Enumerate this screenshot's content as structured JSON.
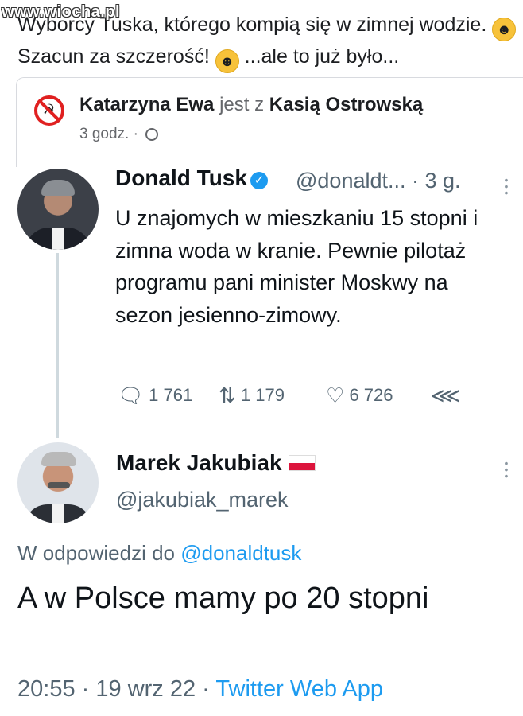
{
  "watermark": "www.wiocha.pl",
  "post": {
    "line1": "Wyborcy Tuska, którego kompią się w zimnej wodzie.",
    "line2_a": "Szacun za szczerość!",
    "line2_b": "...ale to już było...",
    "emoji_laugh": "laughing-emoji"
  },
  "shared": {
    "author": "Katarzyna Ewa",
    "with_word": "jest z",
    "with_name": "Kasią Ostrowską",
    "time": "3 godz.",
    "separator": "·"
  },
  "tweet1": {
    "name": "Donald Tusk",
    "handle": "@donaldt...",
    "time": "· 3 g.",
    "verified_icon": "verified-badge-icon",
    "text": "U znajomych w mieszkaniu 15 stopni i zimna woda w kranie. Pewnie pilotaż programu pani minister Moskwy na sezon jesienno-zimowy.",
    "replies": "1 761",
    "retweets": "1 179",
    "likes": "6 726",
    "colors": {
      "verified": "#1d9bf0"
    }
  },
  "tweet2": {
    "name": "Marek Jakubiak",
    "handle": "@jakubiak_marek",
    "reply_prefix": "W odpowiedzi do",
    "reply_mention": "@donaldtusk",
    "text": "A w Polsce mamy po 20 stopni",
    "time": "20:55",
    "date": "19 wrz 22",
    "app": "Twitter Web App",
    "sep": "·",
    "colors": {
      "link": "#1d9bf0"
    }
  }
}
